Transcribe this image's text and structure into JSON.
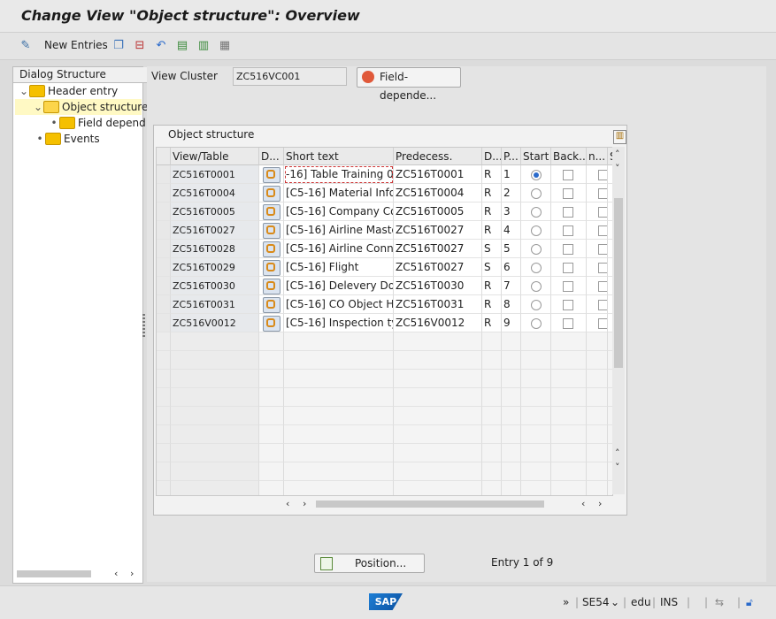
{
  "window": {
    "title": "Change View \"Object structure\": Overview"
  },
  "toolbar": {
    "new_entries_label": "New Entries"
  },
  "tree": {
    "header": "Dialog Structure",
    "items": [
      {
        "label": "Header entry",
        "level": 0,
        "expanded": true,
        "selected": false
      },
      {
        "label": "Object structure",
        "level": 1,
        "expanded": true,
        "selected": true
      },
      {
        "label": "Field depend",
        "level": 2,
        "expanded": false,
        "selected": false
      },
      {
        "label": "Events",
        "level": 1,
        "expanded": false,
        "selected": false
      }
    ]
  },
  "view_cluster": {
    "label": "View Cluster",
    "value": "ZC516VC001",
    "button_label": "Field-depende..."
  },
  "table": {
    "title": "Object structure",
    "columns": [
      "View/Table",
      "D...",
      "Short text",
      "Predecess.",
      "D...",
      "P...",
      "Start",
      "Back...",
      "n...",
      "S"
    ],
    "rows": [
      {
        "view": "ZC516T0001",
        "short": "-16] Table Training 01",
        "pred": "ZC516T0001",
        "d": "R",
        "p": "1",
        "start": true
      },
      {
        "view": "ZC516T0004",
        "short": "[C5-16] Material Info...",
        "pred": "ZC516T0004",
        "d": "R",
        "p": "2",
        "start": false
      },
      {
        "view": "ZC516T0005",
        "short": "[C5-16] Company Co...",
        "pred": "ZC516T0005",
        "d": "R",
        "p": "3",
        "start": false
      },
      {
        "view": "ZC516T0027",
        "short": "[C5-16] Airline Master",
        "pred": "ZC516T0027",
        "d": "R",
        "p": "4",
        "start": false
      },
      {
        "view": "ZC516T0028",
        "short": "[C5-16] Airline Conn...",
        "pred": "ZC516T0027",
        "d": "S",
        "p": "5",
        "start": false
      },
      {
        "view": "ZC516T0029",
        "short": "[C5-16] Flight",
        "pred": "ZC516T0027",
        "d": "S",
        "p": "6",
        "start": false
      },
      {
        "view": "ZC516T0030",
        "short": "[C5-16] Delevery Do...",
        "pred": "ZC516T0030",
        "d": "R",
        "p": "7",
        "start": false
      },
      {
        "view": "ZC516T0031",
        "short": "[C5-16] CO Object H...",
        "pred": "ZC516T0031",
        "d": "R",
        "p": "8",
        "start": false
      },
      {
        "view": "ZC516V0012",
        "short": "[C5-16] Inspection ty...",
        "pred": "ZC516V0012",
        "d": "R",
        "p": "9",
        "start": false
      }
    ]
  },
  "footer": {
    "position_label": "Position...",
    "entry_info": "Entry 1 of 9"
  },
  "status": {
    "logo": "SAP",
    "tcode": "SE54",
    "client": "edu",
    "mode": "INS",
    "more": "»"
  },
  "colors": {
    "accent": "#2a6acb",
    "selected_tree": "#fff9c4",
    "folder": "#f5c000"
  }
}
